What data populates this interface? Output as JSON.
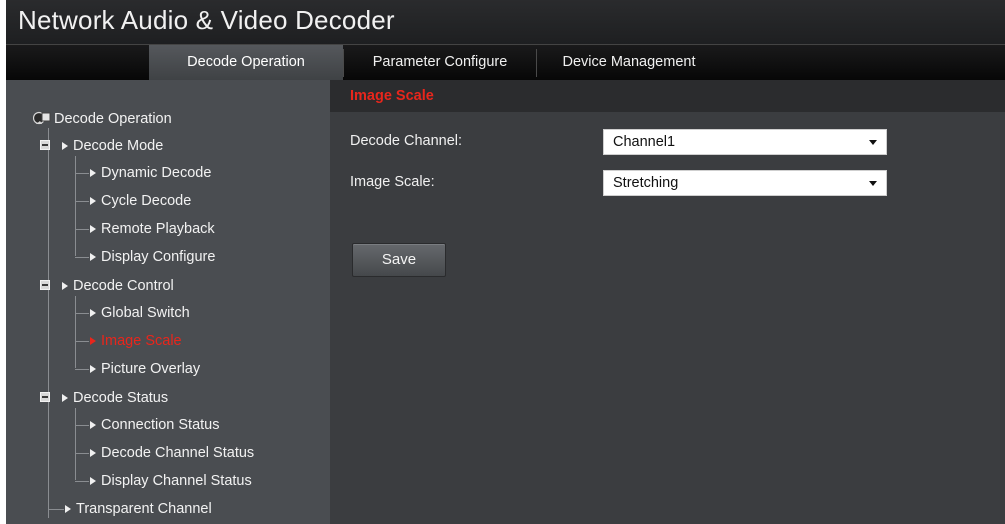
{
  "app": {
    "title": "Network Audio & Video Decoder"
  },
  "menu": {
    "items": [
      {
        "label": "Decode Operation",
        "active": true
      },
      {
        "label": "Parameter Configure",
        "active": false
      },
      {
        "label": "Device Management",
        "active": false
      }
    ]
  },
  "tree": {
    "root": {
      "label": "Decode Operation",
      "icon": "decoder-icon"
    },
    "groups": [
      {
        "label": "Decode Mode",
        "expanded": true,
        "items": [
          {
            "label": "Dynamic Decode"
          },
          {
            "label": "Cycle Decode"
          },
          {
            "label": "Remote Playback"
          },
          {
            "label": "Display Configure"
          }
        ]
      },
      {
        "label": "Decode Control",
        "expanded": true,
        "items": [
          {
            "label": "Global Switch"
          },
          {
            "label": "Image Scale",
            "active": true
          },
          {
            "label": "Picture Overlay"
          }
        ]
      },
      {
        "label": "Decode Status",
        "expanded": true,
        "items": [
          {
            "label": "Connection Status"
          },
          {
            "label": "Decode Channel Status"
          },
          {
            "label": "Display Channel Status"
          }
        ]
      }
    ],
    "extra": {
      "label": "Transparent Channel"
    }
  },
  "page": {
    "section_title": "Image Scale",
    "fields": {
      "decode_channel": {
        "label": "Decode Channel:",
        "value": "Channel1"
      },
      "image_scale": {
        "label": "Image Scale:",
        "value": "Stretching"
      }
    },
    "save_label": "Save"
  },
  "colors": {
    "accent_red": "#e8261c",
    "sidebar_bg": "#4a4d51",
    "content_bg": "#3b3d40",
    "menubar_bg": "#0f0f10"
  }
}
